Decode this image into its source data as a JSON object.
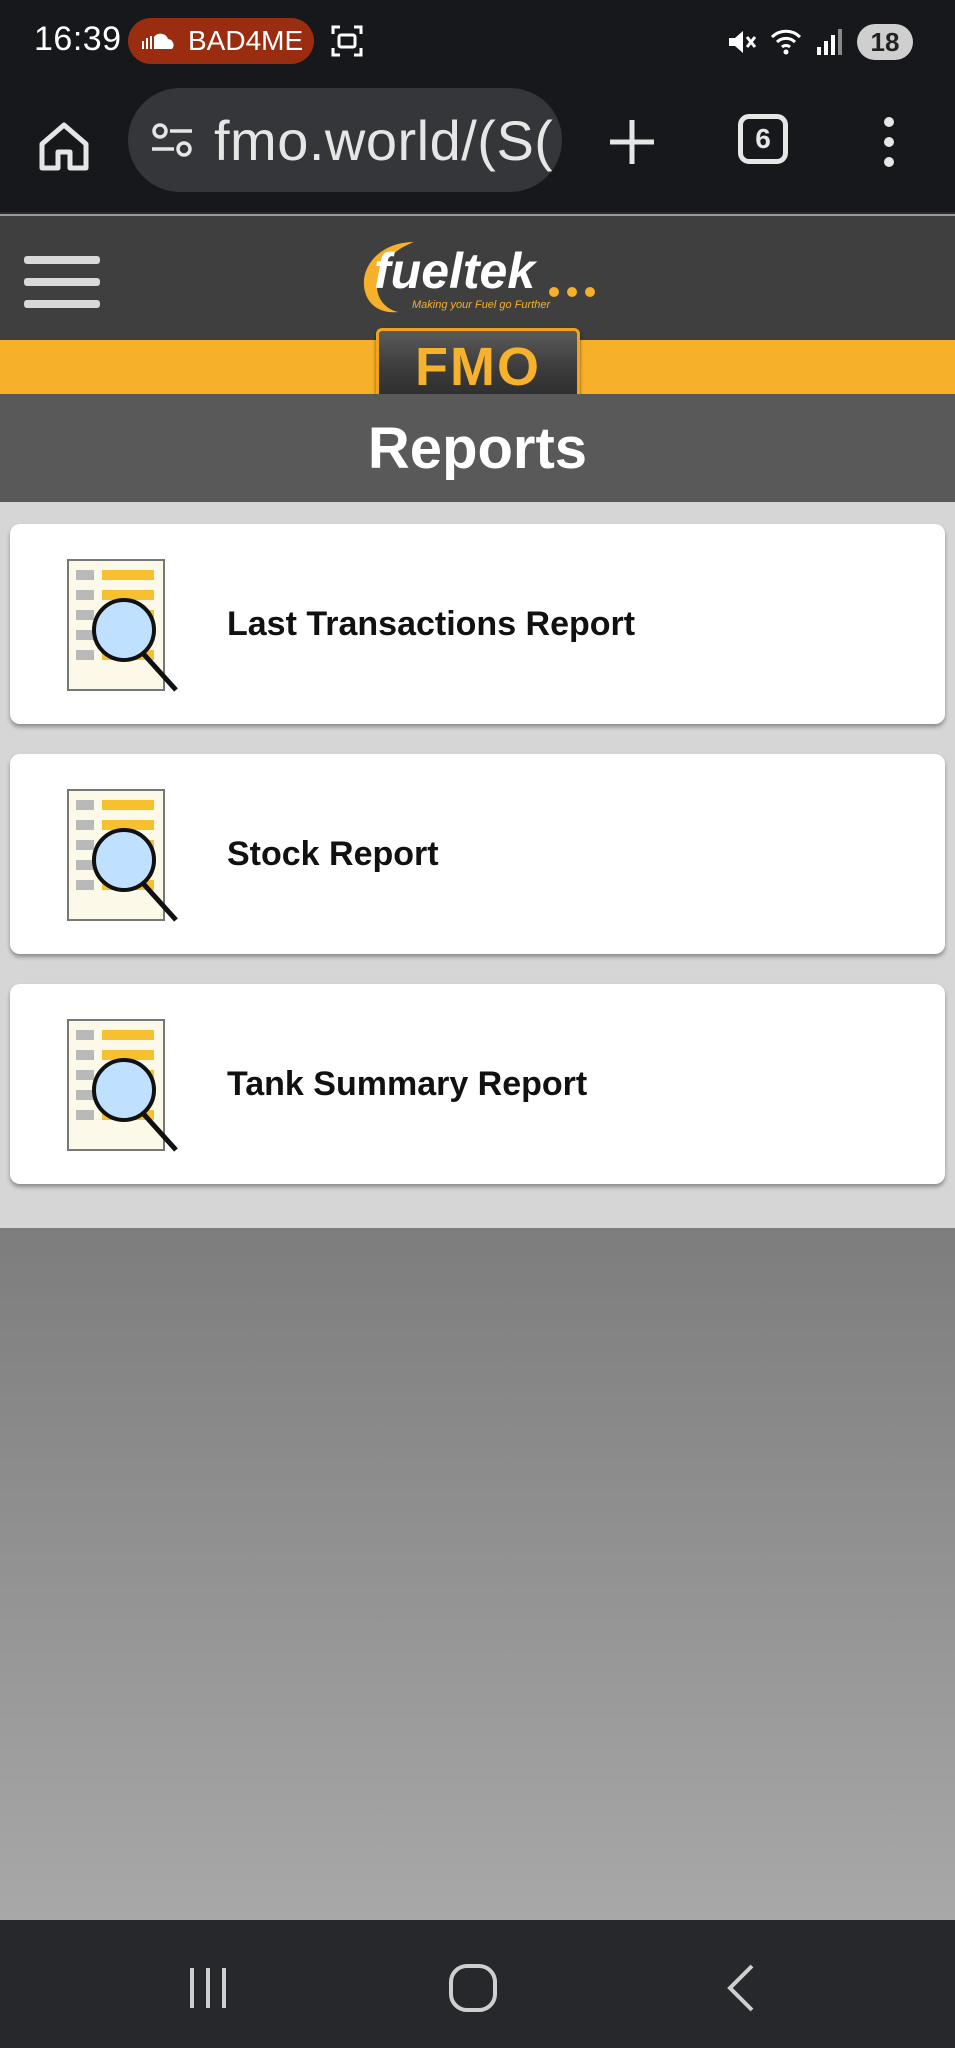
{
  "status_bar": {
    "time": "16:39",
    "notification_label": "BAD4ME",
    "battery": "18",
    "icons": [
      "cloud-icon",
      "screenshot-icon",
      "mute-icon",
      "wifi-icon",
      "signal-icon"
    ]
  },
  "browser": {
    "url": "fmo.world/(S(",
    "tab_count": "6"
  },
  "app": {
    "logo_text": "fueltek",
    "tagline": "Making your Fuel go Further",
    "badge": "FMO",
    "page_title": "Reports"
  },
  "reports": [
    {
      "label": "Last Transactions Report",
      "icon": "report-search-icon"
    },
    {
      "label": "Stock Report",
      "icon": "report-search-icon"
    },
    {
      "label": "Tank Summary Report",
      "icon": "report-search-icon"
    }
  ],
  "colors": {
    "accent": "#f6b02a",
    "header": "#3f3f3f",
    "title_bar": "#595959",
    "status_bar": "#17181b",
    "notification_pill": "#9a2c10"
  }
}
